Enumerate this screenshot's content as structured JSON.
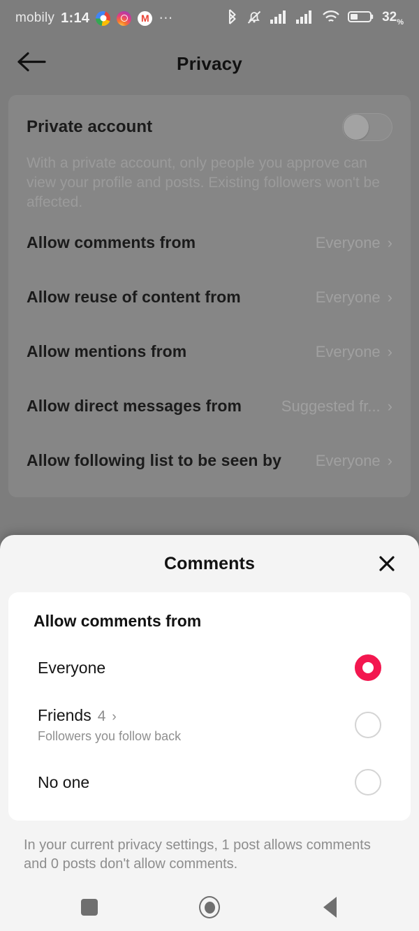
{
  "status_bar": {
    "carrier": "mobily",
    "time": "1:14",
    "app_icons": [
      "google-icon",
      "instagram-icon",
      "gmail-icon"
    ],
    "overflow": "⋯",
    "right_icons": [
      "bluetooth-icon",
      "notifications-muted-icon",
      "signal-bars-icon",
      "signal-bars-icon",
      "wifi-icon",
      "battery-icon"
    ],
    "battery_percent": "32",
    "battery_unit": "%"
  },
  "header": {
    "back_label": "Back",
    "title": "Privacy"
  },
  "privacy": {
    "private_account": {
      "label": "Private account",
      "toggle_state": "off",
      "description": "With a private account, only people you approve can view your profile and posts. Existing followers won't be affected."
    },
    "rows": [
      {
        "label": "Allow comments from",
        "value": "Everyone",
        "chevron": "›"
      },
      {
        "label": "Allow reuse of content from",
        "value": "Everyone",
        "chevron": "›"
      },
      {
        "label": "Allow mentions from",
        "value": "Everyone",
        "chevron": "›"
      },
      {
        "label": "Allow direct messages from",
        "value": "Suggested fr...",
        "chevron": "›"
      },
      {
        "label": "Allow following list to be seen by",
        "value": "Everyone",
        "chevron": "›"
      }
    ]
  },
  "sheet": {
    "title": "Comments",
    "close_label": "✕",
    "section_title": "Allow comments from",
    "options": [
      {
        "label": "Everyone",
        "count": "",
        "chevron": "",
        "subtitle": "",
        "selected": true
      },
      {
        "label": "Friends",
        "count": "4",
        "chevron": "›",
        "subtitle": "Followers you follow back",
        "selected": false
      },
      {
        "label": "No one",
        "count": "",
        "chevron": "",
        "subtitle": "",
        "selected": false
      }
    ],
    "footnote": "In your current privacy settings, 1 post allows comments and 0 posts don't allow comments."
  },
  "nav_bar": {
    "recents_label": "Recents",
    "home_label": "Home",
    "back_label": "Back"
  },
  "colors": {
    "accent": "#f3174f",
    "sheet_bg": "#f4f4f4",
    "card_bg": "#ffffff",
    "scrim": "#7d7d7d"
  }
}
